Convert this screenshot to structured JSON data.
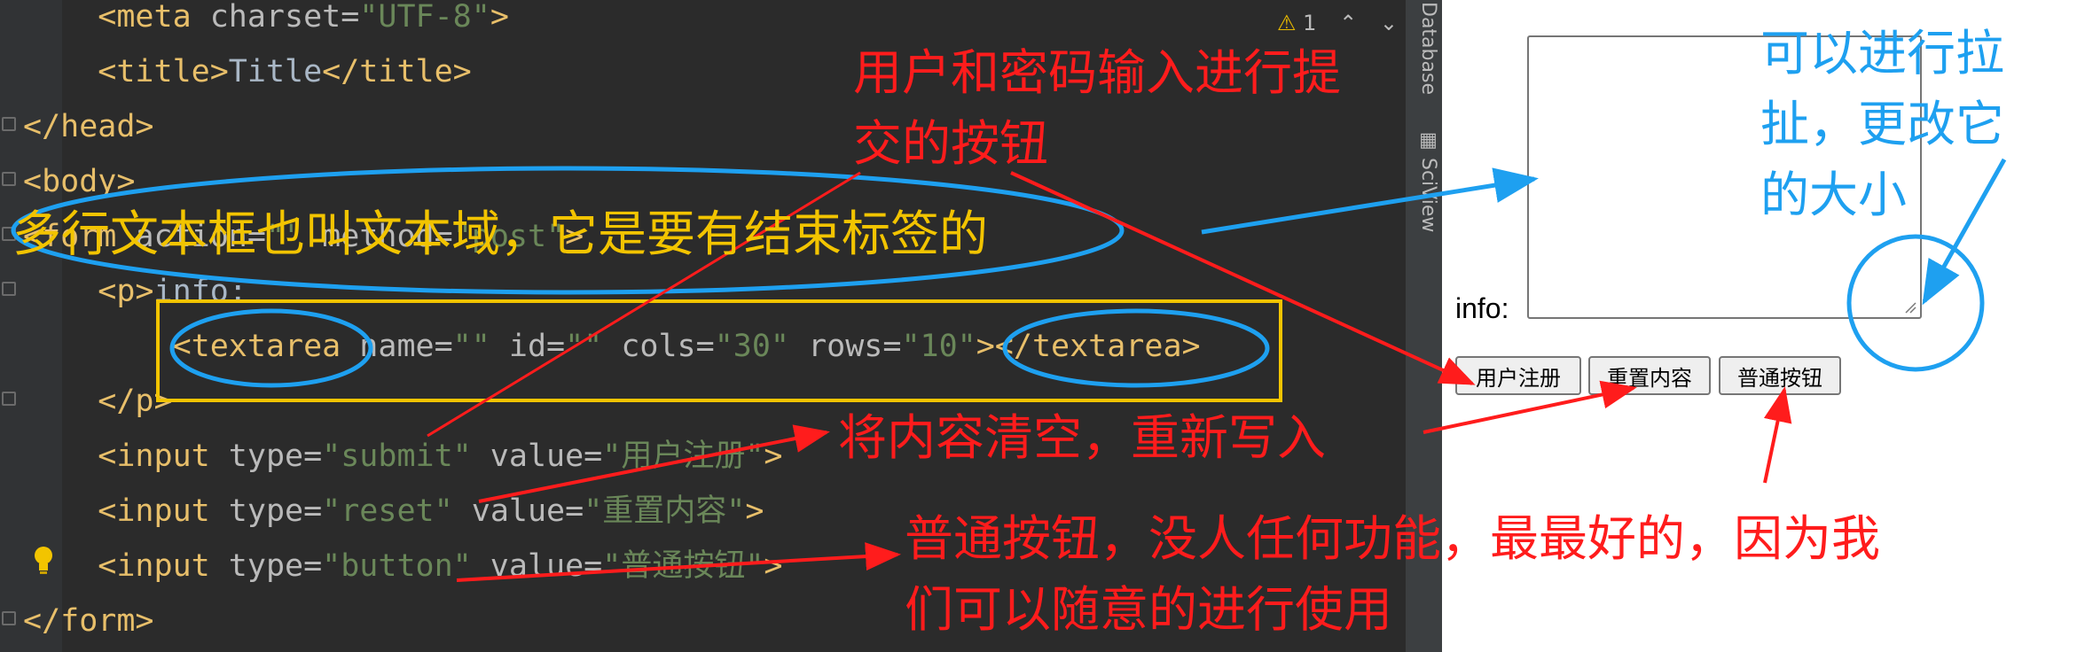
{
  "code_lines": [
    {
      "id": "meta",
      "parts": [
        {
          "c": "tag",
          "t": "    <meta "
        },
        {
          "c": "attr",
          "t": "charset="
        },
        {
          "c": "str",
          "t": "\"UTF-8\""
        },
        {
          "c": "tag",
          "t": ">"
        }
      ]
    },
    {
      "id": "title",
      "parts": [
        {
          "c": "tag",
          "t": "    <title>"
        },
        {
          "c": "txt",
          "t": "Title"
        },
        {
          "c": "tag",
          "t": "</title>"
        }
      ]
    },
    {
      "id": "head-close",
      "parts": [
        {
          "c": "tag",
          "t": "</head>"
        }
      ]
    },
    {
      "id": "body-open",
      "parts": [
        {
          "c": "tag",
          "t": "<body>"
        }
      ]
    },
    {
      "id": "form-open",
      "parts": [
        {
          "c": "tag",
          "t": "<form "
        },
        {
          "c": "attr",
          "t": "action="
        },
        {
          "c": "str",
          "t": "\"\""
        },
        {
          "c": "attr",
          "t": " method="
        },
        {
          "c": "str",
          "t": "\"post\""
        },
        {
          "c": "tag",
          "t": ">"
        }
      ]
    },
    {
      "id": "p-open",
      "parts": [
        {
          "c": "tag",
          "t": "    <p>"
        },
        {
          "c": "txt",
          "t": "info:"
        }
      ]
    },
    {
      "id": "textarea",
      "parts": [
        {
          "c": "tag",
          "t": "        <textarea "
        },
        {
          "c": "attr",
          "t": "name="
        },
        {
          "c": "str",
          "t": "\"\""
        },
        {
          "c": "attr",
          "t": " id="
        },
        {
          "c": "str",
          "t": "\"\""
        },
        {
          "c": "attr",
          "t": " cols="
        },
        {
          "c": "str",
          "t": "\"30\""
        },
        {
          "c": "attr",
          "t": " rows="
        },
        {
          "c": "str",
          "t": "\"10\""
        },
        {
          "c": "tag",
          "t": "></textarea>"
        }
      ]
    },
    {
      "id": "p-close",
      "parts": [
        {
          "c": "tag",
          "t": "    </p>"
        }
      ]
    },
    {
      "id": "input-submit",
      "parts": [
        {
          "c": "tag",
          "t": "    <input "
        },
        {
          "c": "attr",
          "t": "type="
        },
        {
          "c": "str",
          "t": "\"submit\""
        },
        {
          "c": "attr",
          "t": " value="
        },
        {
          "c": "str",
          "t": "\"用户注册\""
        },
        {
          "c": "tag",
          "t": ">"
        }
      ]
    },
    {
      "id": "input-reset",
      "parts": [
        {
          "c": "tag",
          "t": "    <input "
        },
        {
          "c": "attr",
          "t": "type="
        },
        {
          "c": "str",
          "t": "\"reset\""
        },
        {
          "c": "attr",
          "t": " value="
        },
        {
          "c": "str",
          "t": "\"重置内容\""
        },
        {
          "c": "tag",
          "t": ">"
        }
      ]
    },
    {
      "id": "input-button",
      "parts": [
        {
          "c": "tag",
          "t": "    <input "
        },
        {
          "c": "attr",
          "t": "type="
        },
        {
          "c": "str",
          "t": "\"button\""
        },
        {
          "c": "attr",
          "t": " value="
        },
        {
          "c": "str",
          "t": "\"普通按钮\""
        },
        {
          "c": "tag",
          "t": ">"
        }
      ]
    },
    {
      "id": "form-close",
      "parts": [
        {
          "c": "tag",
          "t": "</form>"
        }
      ]
    }
  ],
  "editor": {
    "warning_count": "1"
  },
  "side_tabs": {
    "database": "Database",
    "sciview": "SciView"
  },
  "browser": {
    "info_label": "info:",
    "buttons": {
      "submit": "用户注册",
      "reset": "重置内容",
      "normal": "普通按钮"
    }
  },
  "annotations": {
    "submit_note": "用户和密码输入进行提\n交的按钮",
    "textarea_note": "多行文本框也叫文本域，它是要有结束标签的",
    "resize_note": "可以进行拉\n扯，更改它\n的大小",
    "reset_note": "将内容清空，重新写入",
    "button_note": "普通按钮，没人任何功能，最最好的，因为我\n们可以随意的进行使用"
  },
  "colors": {
    "red": "#ff1c1c",
    "yellow": "#f2c400",
    "blue": "#1ea0f0"
  }
}
